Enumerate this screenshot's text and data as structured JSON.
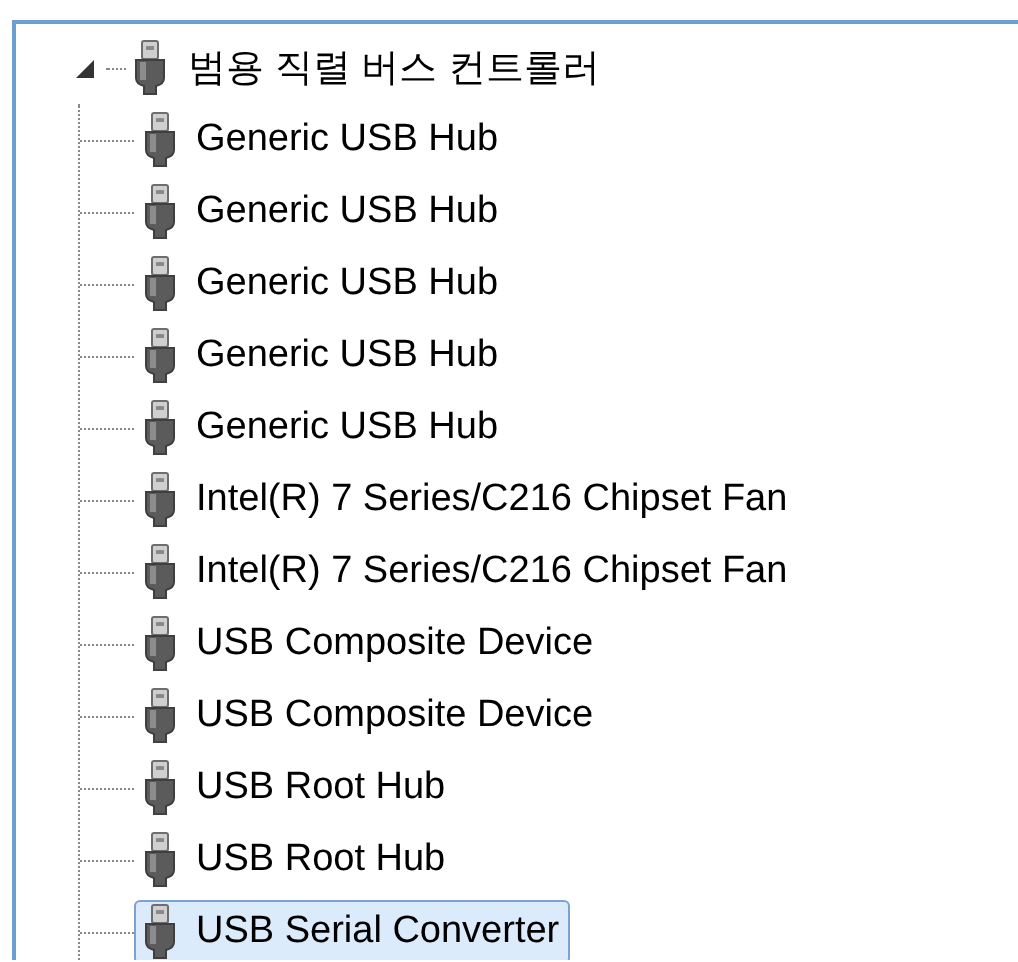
{
  "tree": {
    "label": "범용 직렬 버스 컨트롤러",
    "expanded": true,
    "selected": false,
    "children": [
      {
        "label": "Generic USB Hub",
        "selected": false
      },
      {
        "label": "Generic USB Hub",
        "selected": false
      },
      {
        "label": "Generic USB Hub",
        "selected": false
      },
      {
        "label": "Generic USB Hub",
        "selected": false
      },
      {
        "label": "Generic USB Hub",
        "selected": false
      },
      {
        "label": "Intel(R) 7 Series/C216 Chipset Fan",
        "selected": false
      },
      {
        "label": "Intel(R) 7 Series/C216 Chipset Fan",
        "selected": false
      },
      {
        "label": "USB Composite Device",
        "selected": false
      },
      {
        "label": "USB Composite Device",
        "selected": false
      },
      {
        "label": "USB Root Hub",
        "selected": false
      },
      {
        "label": "USB Root Hub",
        "selected": false
      },
      {
        "label": "USB Serial Converter",
        "selected": true
      }
    ]
  }
}
